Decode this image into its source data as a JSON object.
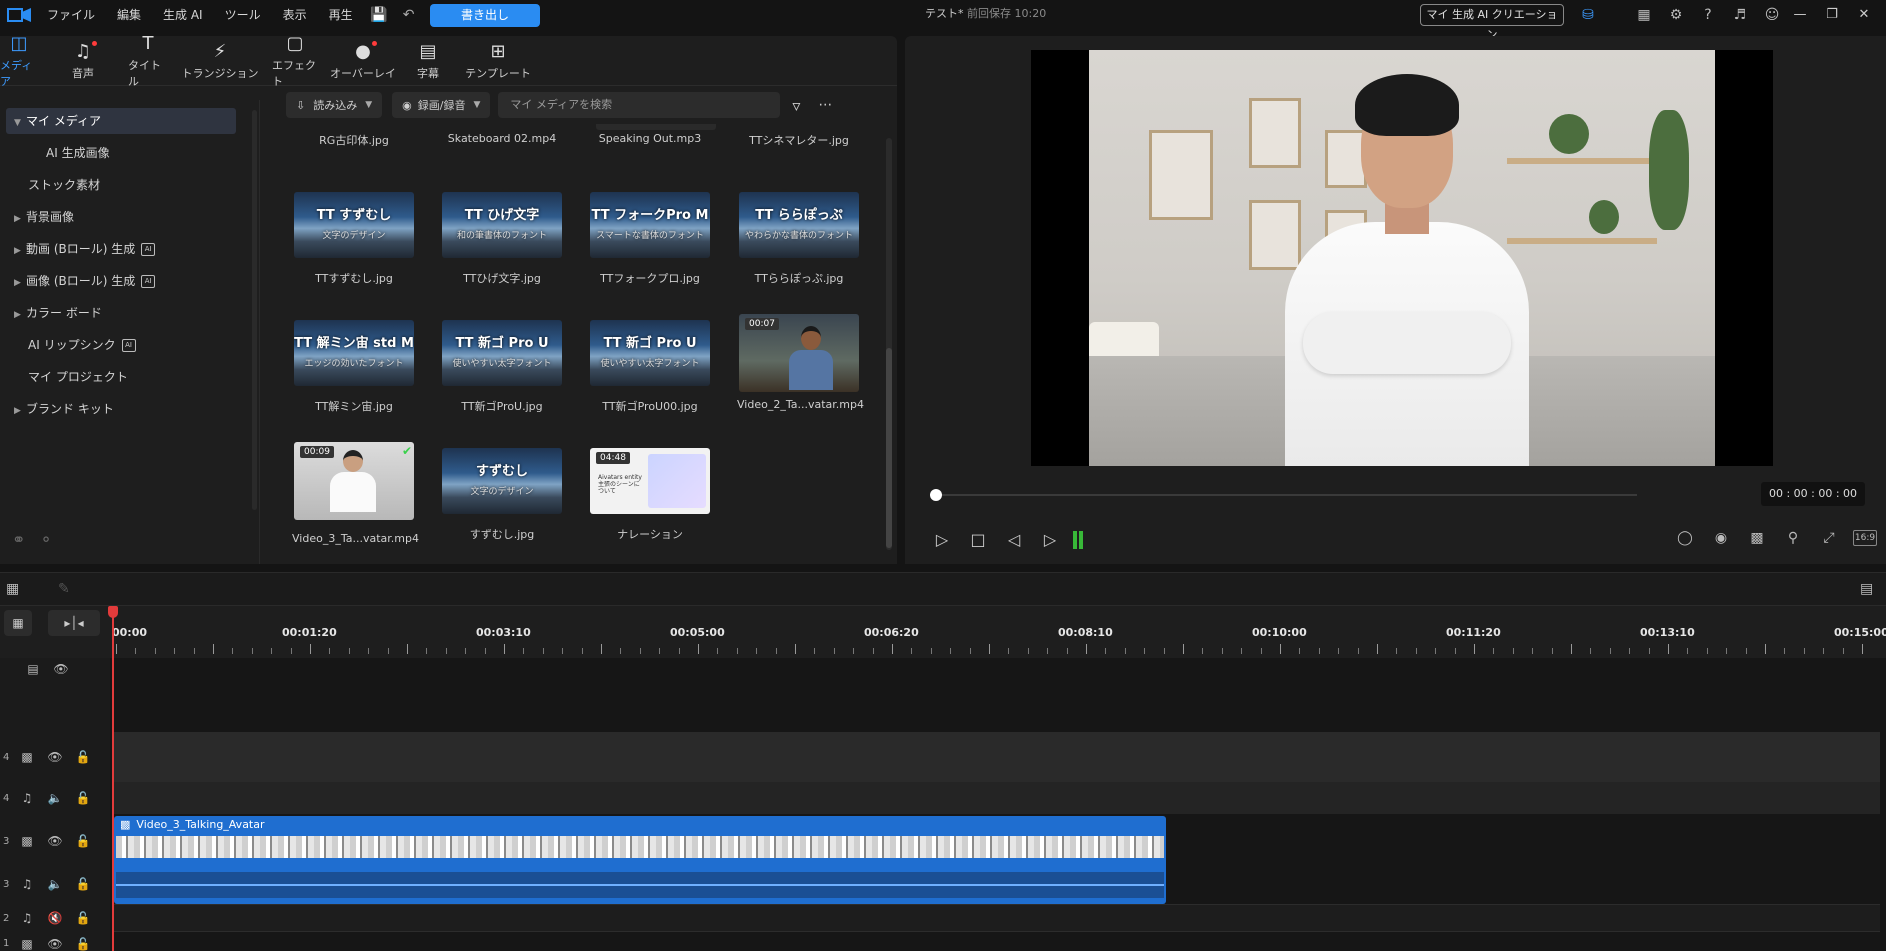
{
  "menubar": {
    "items": [
      "ファイル",
      "編集",
      "生成 AI",
      "ツール",
      "表示",
      "再生"
    ],
    "export_label": "書き出し",
    "project_title": "テスト*",
    "project_saved": "前回保存 10:20",
    "genai_button": "マイ 生成 AI クリエーション",
    "accent_color": "#2a8cf2"
  },
  "library_tabs": [
    {
      "label": "メディア",
      "icon": "media-icon"
    },
    {
      "label": "音声",
      "icon": "music-icon"
    },
    {
      "label": "タイトル",
      "icon": "title-icon"
    },
    {
      "label": "トランジション",
      "icon": "transition-icon"
    },
    {
      "label": "エフェクト",
      "icon": "effect-icon"
    },
    {
      "label": "オーバーレイ",
      "icon": "overlay-icon"
    },
    {
      "label": "字幕",
      "icon": "subtitle-icon"
    },
    {
      "label": "テンプレート",
      "icon": "template-icon"
    }
  ],
  "sidebar": {
    "items": [
      {
        "label": "マイ メディア"
      },
      {
        "label": "AI 生成画像"
      },
      {
        "label": "ストック素材"
      },
      {
        "label": "背景画像"
      },
      {
        "label": "動画 (Bロール) 生成"
      },
      {
        "label": "画像 (Bロール) 生成"
      },
      {
        "label": "カラー ボード"
      },
      {
        "label": "AI リップシンク"
      },
      {
        "label": "マイ プロジェクト"
      },
      {
        "label": "ブランド キット"
      }
    ],
    "ai_badge": "AI"
  },
  "toolbar": {
    "import_label": "読み込み",
    "record_label": "録画/録音",
    "search_placeholder": "マイ メディアを検索"
  },
  "media": {
    "top_labels": [
      "RG古印体.jpg",
      "Skateboard 02.mp4",
      "Speaking Out.mp3",
      "TTシネマレター.jpg"
    ],
    "items": [
      {
        "label": "TTすずむし.jpg",
        "thumb_text": "TT すずむし",
        "thumb_sub": "文字のデザイン"
      },
      {
        "label": "TTひげ文字.jpg",
        "thumb_text": "TT ひげ文字",
        "thumb_sub": "和の筆書体のフォント"
      },
      {
        "label": "TTフォークプロ.jpg",
        "thumb_text": "TT フォークPro M",
        "thumb_sub": "スマートな書体のフォント"
      },
      {
        "label": "TTららぽっぷ.jpg",
        "thumb_text": "TT ららぽっぷ",
        "thumb_sub": "やわらかな書体のフォント"
      },
      {
        "label": "TT解ミン宙.jpg",
        "thumb_text": "TT 解ミン宙 std M",
        "thumb_sub": "エッジの効いたフォント"
      },
      {
        "label": "TT新ゴProU.jpg",
        "thumb_text": "TT 新ゴ Pro U",
        "thumb_sub": "使いやすい太字フォント"
      },
      {
        "label": "TT新ゴProU00.jpg",
        "thumb_text": "TT 新ゴ Pro U",
        "thumb_sub": "使いやすい太字フォント"
      },
      {
        "label": "Video_2_Ta...vatar.mp4",
        "duration": "00:07"
      },
      {
        "label": "Video_3_Ta...vatar.mp4",
        "duration": "00:09"
      },
      {
        "label": "すずむし.jpg",
        "thumb_text": "すずむし",
        "thumb_sub": "文字のデザイン"
      },
      {
        "label": "ナレーション",
        "duration": "04:48",
        "thumb_text": "Aivatars entity 主張のシーンについて"
      }
    ]
  },
  "preview": {
    "timecode": "00 : 00 : 00 : 00",
    "aspect": "16:9"
  },
  "timeline": {
    "ruler": [
      "00:00",
      "00:01:20",
      "00:03:10",
      "00:05:00",
      "00:06:20",
      "00:08:10",
      "00:10:00",
      "00:11:20",
      "00:13:10",
      "00:15:00"
    ],
    "tracks": [
      "4",
      "4",
      "3",
      "3",
      "2",
      "1"
    ],
    "clip_title": "Video_3_Talking_Avatar"
  }
}
